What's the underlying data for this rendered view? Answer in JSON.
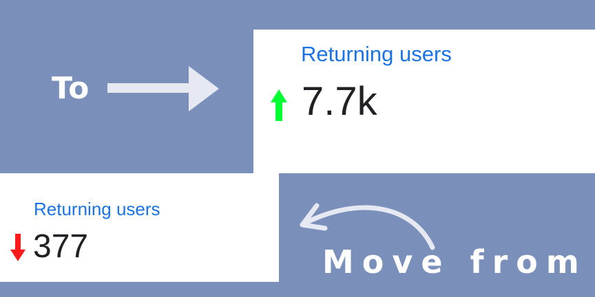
{
  "top_card": {
    "title": "Returning users",
    "value": "7.7k",
    "trend": "up",
    "trend_icon": "arrow-up-icon",
    "trend_color": "#00ff33"
  },
  "bottom_card": {
    "title": "Returning users",
    "value": "377",
    "trend": "down",
    "trend_icon": "arrow-down-icon",
    "trend_color": "#ff1a1a"
  },
  "captions": {
    "to": "To",
    "move_from": "Move from"
  },
  "arrows": {
    "right_arrow_icon": "arrow-right-icon",
    "curved_arrow_icon": "curved-arrow-left-icon"
  },
  "colors": {
    "background": "#7a8fba",
    "card": "#ffffff",
    "title": "#1a73e8",
    "value": "#202124",
    "arrow": "#e6e9f2"
  }
}
